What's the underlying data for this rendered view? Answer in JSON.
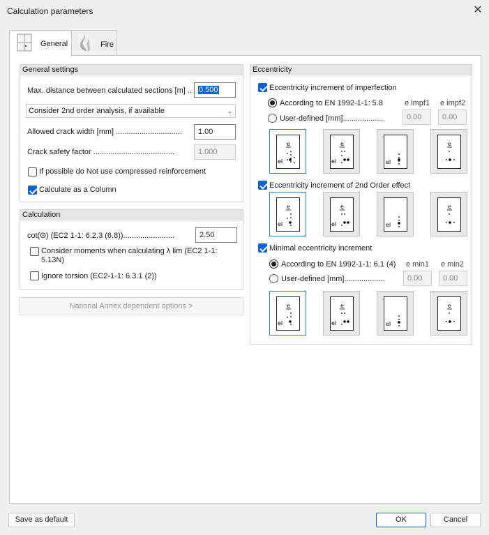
{
  "window": {
    "title": "Calculation parameters"
  },
  "tabs": [
    {
      "label": "General",
      "icon": "section-grid-icon"
    },
    {
      "label": "Fire",
      "icon": "fire-icon"
    }
  ],
  "general_settings": {
    "header": "General settings",
    "max_distance_label": "Max. distance between calculated sections [m] ..",
    "max_distance_value": "0.500",
    "analysis_option": "Consider 2nd order analysis, if available",
    "crack_width_label": "Allowed crack width [mm] ...............................",
    "crack_width_value": "1.00",
    "crack_safety_label": "Crack safety factor ......................................",
    "crack_safety_value": "1.000",
    "no_compressed_label": "If possible do Not use compressed reinforcement",
    "no_compressed_checked": false,
    "as_column_label": "Calculate as a Column",
    "as_column_checked": true
  },
  "calculation": {
    "header": "Calculation",
    "cot_label": "cot(Θ)  (EC2 1-1: 6.2.3 (6.8))........................",
    "cot_value": "2.50",
    "moments_label_1": "Consider moments when calculating λ lim (EC2 1-1:",
    "moments_label_2": "5.13N)",
    "moments_checked": false,
    "torsion_label": "Ignore torsion (EC2-1-1: 6.3.1 (2))",
    "torsion_checked": false
  },
  "national_annex_button": "National Annex dependent options >",
  "eccentricity": {
    "header": "Eccentricity",
    "imperfection": {
      "label": "Eccentricity increment of imperfection",
      "checked": true,
      "radio_standard": "According to EN 1992-1-1: 5.8",
      "radio_user": "User-defined [mm]...................",
      "selected": "standard",
      "col1": "e impf1",
      "col2": "e impf2",
      "val1": "0.00",
      "val2": "0.00"
    },
    "second_order": {
      "label": "Eccentricity increment of 2nd Order effect",
      "checked": true
    },
    "minimal": {
      "label": "Minimal eccentricity increment",
      "checked": true,
      "radio_standard": "According to EN 1992-1-1: 6.1 (4)",
      "radio_user": "User-defined [mm]...................",
      "selected": "standard",
      "col1": "e min1",
      "col2": "e min2",
      "val1": "0.00",
      "val2": "0.00"
    }
  },
  "thumb_labels": {
    "e": "e",
    "ei": "eI"
  },
  "footer": {
    "save_default": "Save as default",
    "ok": "OK",
    "cancel": "Cancel"
  },
  "colors": {
    "accent": "#0a64d0",
    "thumb_selected_border": "#2f7ec0"
  }
}
